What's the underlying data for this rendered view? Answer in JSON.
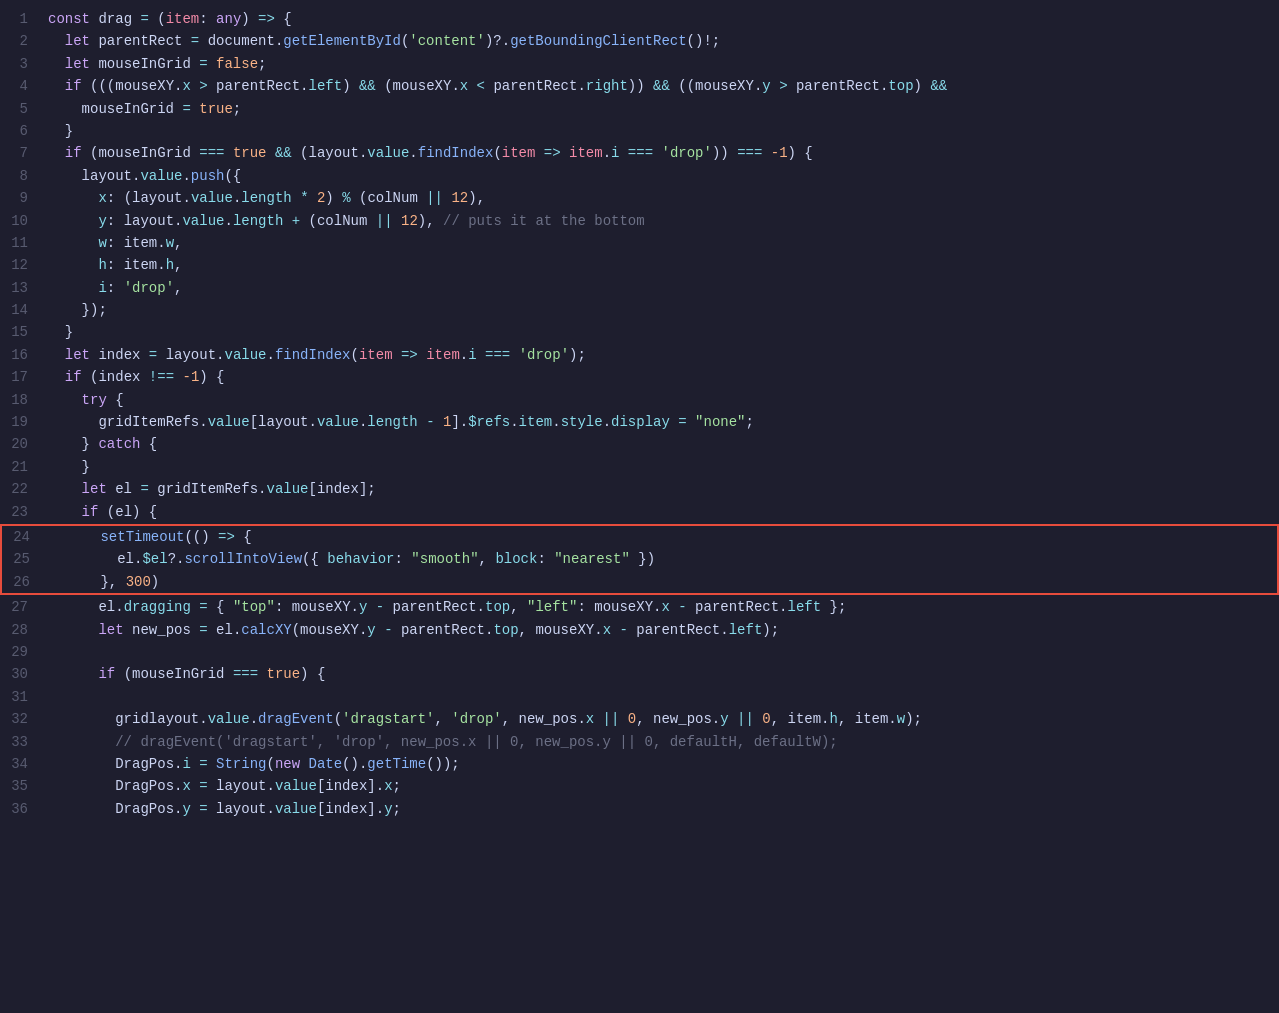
{
  "editor": {
    "background": "#1e1e2e",
    "lines": []
  },
  "highlight_box_label": "setTimeout block highlighted",
  "colors": {
    "keyword": "#cba6f7",
    "function": "#89b4fa",
    "string_green": "#a6e3a1",
    "string_orange": "#fab387",
    "number": "#fab387",
    "property": "#89dceb",
    "comment": "#6c7086",
    "plain": "#cdd6f4",
    "error": "#f38ba8",
    "highlight_border": "#e74c3c"
  }
}
